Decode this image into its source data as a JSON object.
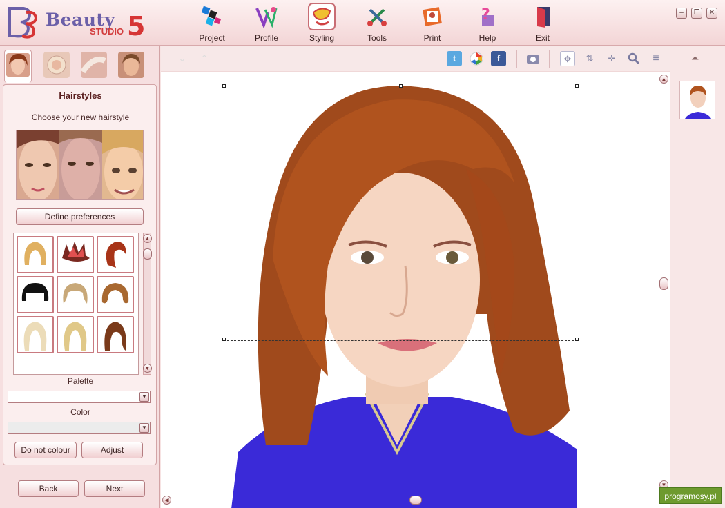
{
  "app": {
    "brand": "Beauty",
    "studio": "STUDIO",
    "version": "5"
  },
  "toolbar": {
    "items": [
      {
        "label": "Project",
        "icon": "project-icon"
      },
      {
        "label": "Profile",
        "icon": "profile-icon"
      },
      {
        "label": "Styling",
        "icon": "styling-icon",
        "active": true
      },
      {
        "label": "Tools",
        "icon": "tools-icon"
      },
      {
        "label": "Print",
        "icon": "print-icon"
      },
      {
        "label": "Help",
        "icon": "help-icon"
      },
      {
        "label": "Exit",
        "icon": "exit-icon"
      }
    ]
  },
  "panel": {
    "title": "Hairstyles",
    "subtitle": "Choose your new hairstyle",
    "define_preferences": "Define preferences",
    "palette_label": "Palette",
    "palette_value": "",
    "color_label": "Color",
    "color_value": "",
    "do_not_colour": "Do not colour",
    "adjust": "Adjust",
    "back": "Back",
    "next": "Next",
    "hairstyles": [
      "blonde-bob",
      "spiky-red",
      "red-swept",
      "black-fringe",
      "blonde-wavy",
      "auburn-curly",
      "platinum-long",
      "blonde-long",
      "brown-curly-long"
    ]
  },
  "colors": {
    "accent": "#c86d74",
    "panel_bg": "#f6dfe0",
    "brand_purple": "#6b5fa8",
    "brand_red": "#d63535"
  },
  "watermark": "programosy.pl"
}
